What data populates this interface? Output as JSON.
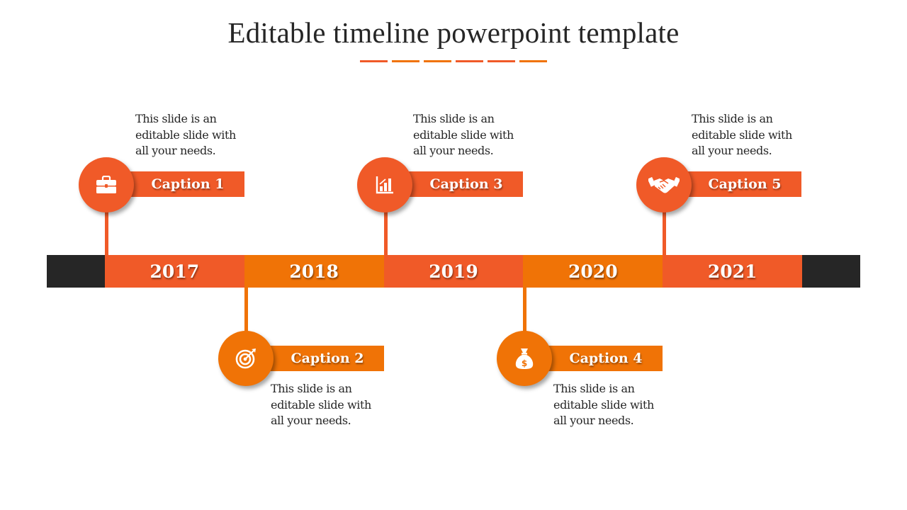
{
  "slide": {
    "title": "Editable timeline powerpoint template",
    "title_underline_colors": [
      "#f05a28",
      "#f07306",
      "#f07306",
      "#f05a28",
      "#f05a28",
      "#f07306"
    ]
  },
  "colors": {
    "primary_orange": "#f05a28",
    "secondary_orange": "#f07306",
    "dark_bar": "#262626",
    "text": "#262626",
    "white": "#ffffff"
  },
  "timeline": {
    "years": [
      {
        "label": "2017",
        "color": "#f05a28"
      },
      {
        "label": "2018",
        "color": "#f07306"
      },
      {
        "label": "2019",
        "color": "#f05a28"
      },
      {
        "label": "2020",
        "color": "#f07306"
      },
      {
        "label": "2021",
        "color": "#f05a28"
      }
    ]
  },
  "milestones": [
    {
      "caption": "Caption 1",
      "icon": "briefcase-icon",
      "description": "This slide is an editable slide with all your needs.",
      "position": "above",
      "year": "2017",
      "color": "#f05a28"
    },
    {
      "caption": "Caption 2",
      "icon": "target-icon",
      "description": "This slide is an editable slide with all your needs.",
      "position": "below",
      "year": "2018",
      "color": "#f07306"
    },
    {
      "caption": "Caption 3",
      "icon": "bar-chart-icon",
      "description": "This slide is an editable slide with all your needs.",
      "position": "above",
      "year": "2019",
      "color": "#f05a28"
    },
    {
      "caption": "Caption 4",
      "icon": "money-bag-icon",
      "description": "This slide is an editable slide with all your needs.",
      "position": "below",
      "year": "2020",
      "color": "#f07306"
    },
    {
      "caption": "Caption 5",
      "icon": "handshake-icon",
      "description": "This slide is an editable slide with all your needs.",
      "position": "above",
      "year": "2021",
      "color": "#f05a28"
    }
  ]
}
